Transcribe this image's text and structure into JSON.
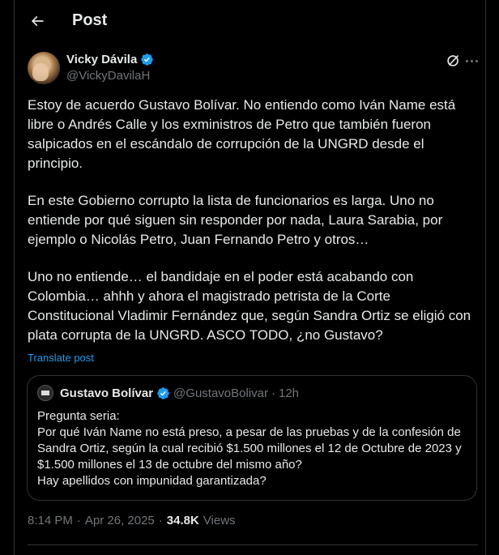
{
  "header": {
    "title": "Post"
  },
  "author": {
    "name": "Vicky Dávila",
    "handle": "@VickyDavilaH"
  },
  "tweet": {
    "paragraphs": [
      "Estoy de acuerdo Gustavo Bolívar. No entiendo como Iván Name está libre o Andrés Calle y los exministros de Petro que también fueron salpicados en el escándalo de corrupción de la UNGRD desde el principio.",
      "En este Gobierno corrupto la lista de funcionarios es larga. Uno no entiende por qué siguen sin responder por nada, Laura Sarabia, por ejemplo o Nicolás Petro, Juan Fernando Petro y otros…",
      "Uno no entiende… el bandidaje en el poder está acabando con Colombia… ahhh y ahora el magistrado petrista de la Corte Constitucional Vladimir Fernández que, según Sandra Ortiz se eligió con plata corrupta de la UNGRD. ASCO TODO, ¿no Gustavo?"
    ],
    "translate_label": "Translate post"
  },
  "quote": {
    "name": "Gustavo Bolívar",
    "handle": "@GustavoBolivar",
    "separator": "·",
    "time": "12h",
    "lines": [
      "Pregunta seria:",
      "Por qué Iván Name no está preso, a pesar de las pruebas y de la confesión de Sandra Ortiz, según la cual recibió $1.500 millones el 12 de Octubre de 2023 y $1.500 millones el 13 de octubre del mismo año?",
      "Hay apellidos con impunidad garantizada?"
    ]
  },
  "meta": {
    "time": "8:14 PM",
    "date": "Apr 26, 2025",
    "separator": "·",
    "views_count": "34.8K",
    "views_label": "Views"
  },
  "colors": {
    "accent": "#1d9bf0",
    "background": "#000000",
    "text": "#e7e9ea",
    "muted": "#71767b",
    "border": "#2f3336"
  },
  "icons": {
    "back": "arrow-left",
    "verified": "verified-badge",
    "grok": "grok-icon",
    "more": "more-dots"
  }
}
